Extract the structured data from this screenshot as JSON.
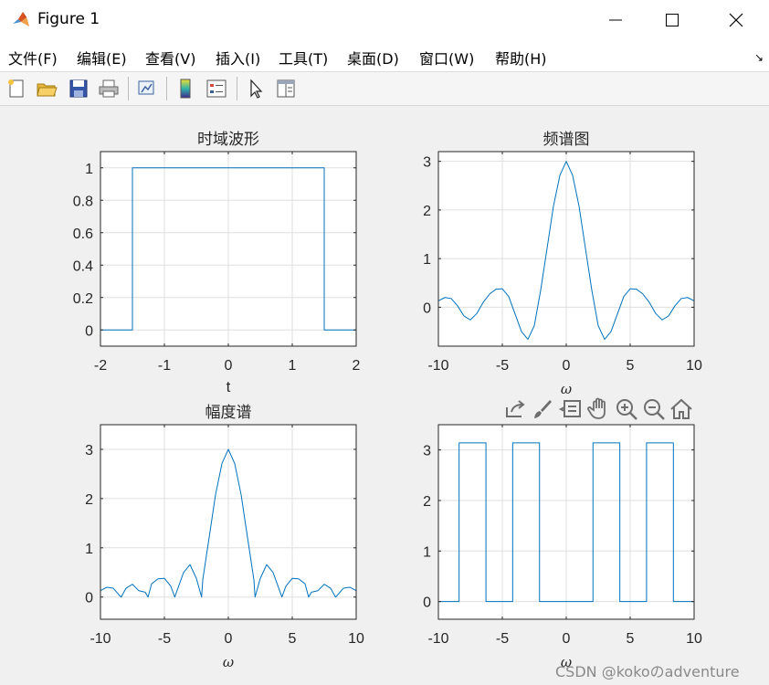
{
  "window": {
    "title": "Figure 1",
    "controls": [
      "minimize-icon",
      "maximize-icon",
      "close-icon"
    ]
  },
  "menu": [
    "文件(F)",
    "编辑(E)",
    "查看(V)",
    "插入(I)",
    "工具(T)",
    "桌面(D)",
    "窗口(W)",
    "帮助(H)"
  ],
  "toolbar": [
    "new-figure-icon",
    "open-file-icon",
    "save-icon",
    "print-icon",
    "link-plot-icon",
    "colorbar-icon",
    "legend-icon",
    "edit-plot-pointer-icon",
    "property-inspector-icon"
  ],
  "axes_toolbar": [
    "export-icon",
    "brush-icon",
    "data-tips-icon",
    "pan-hand-icon",
    "zoom-in-icon",
    "zoom-out-icon",
    "home-icon"
  ],
  "watermark": "CSDN @kokoのadventure",
  "colors": {
    "line": "#0072bd",
    "grid": "#dfdfdf",
    "axes_bg": "#ffffff",
    "figure_bg": "#f0f0f0"
  },
  "chart_data": [
    {
      "type": "line",
      "title": "时域波形",
      "xlabel": "t",
      "ylabel": "",
      "xlim": [
        -2,
        2
      ],
      "ylim": [
        -0.1,
        1.1
      ],
      "xticks": [
        -2,
        -1,
        0,
        1,
        2
      ],
      "yticks": [
        0,
        0.2,
        0.4,
        0.6,
        0.8,
        1
      ],
      "grid": true,
      "series": [
        {
          "x": [
            -2,
            -1.5,
            -1.5,
            1.5,
            1.5,
            2
          ],
          "y": [
            0,
            0,
            1,
            1,
            0,
            0
          ]
        }
      ]
    },
    {
      "type": "line",
      "title": "频谱图",
      "xlabel": "ω",
      "ylabel": "",
      "xlim": [
        -10,
        10
      ],
      "ylim": [
        -0.8,
        3.2
      ],
      "xticks": [
        -10,
        -5,
        0,
        5,
        10
      ],
      "yticks": [
        0,
        1,
        2,
        3
      ],
      "grid": true,
      "series": [
        {
          "x": [
            -10,
            -9.5,
            -9,
            -8.5,
            -8,
            -7.5,
            -7,
            -6.5,
            -6,
            -5.5,
            -5,
            -4.5,
            -4,
            -3.5,
            -3,
            -2.5,
            -2,
            -1.5,
            -1,
            -0.5,
            0,
            0.5,
            1,
            1.5,
            2,
            2.5,
            3,
            3.5,
            4,
            4.5,
            5,
            5.5,
            6,
            6.5,
            7,
            7.5,
            8,
            8.5,
            9,
            9.5,
            10
          ],
          "y": [
            0.13,
            0.2,
            0.18,
            0.03,
            -0.18,
            -0.26,
            -0.13,
            0.1,
            0.27,
            0.37,
            0.38,
            0.22,
            -0.14,
            -0.5,
            -0.66,
            -0.38,
            0.35,
            1.21,
            2.08,
            2.71,
            3.0,
            2.71,
            2.08,
            1.21,
            0.35,
            -0.38,
            -0.66,
            -0.5,
            -0.14,
            0.22,
            0.38,
            0.37,
            0.27,
            0.1,
            -0.13,
            -0.26,
            -0.18,
            0.03,
            0.18,
            0.2,
            0.13
          ]
        }
      ]
    },
    {
      "type": "line",
      "title": "幅度谱",
      "xlabel": "ω",
      "ylabel": "",
      "xlim": [
        -10,
        10
      ],
      "ylim": [
        -0.45,
        3.5
      ],
      "xticks": [
        -10,
        -5,
        0,
        5,
        10
      ],
      "yticks": [
        0,
        1,
        2,
        3
      ],
      "grid": true,
      "series": [
        {
          "x": [
            -10,
            -9.5,
            -9,
            -8.5,
            -8.38,
            -8,
            -7.5,
            -7,
            -6.5,
            -6.28,
            -6,
            -5.5,
            -5,
            -4.5,
            -4.19,
            -4,
            -3.5,
            -3,
            -2.5,
            -2.09,
            -2,
            -1.5,
            -1,
            -0.5,
            0,
            0.5,
            1,
            1.5,
            2,
            2.09,
            2.5,
            3,
            3.5,
            4,
            4.19,
            4.5,
            5,
            5.5,
            6,
            6.28,
            6.5,
            7,
            7.5,
            8,
            8.38,
            8.5,
            9,
            9.5,
            10
          ],
          "y": [
            0.13,
            0.2,
            0.18,
            0.03,
            0.0,
            0.18,
            0.26,
            0.13,
            0.1,
            0.0,
            0.27,
            0.37,
            0.38,
            0.22,
            0.0,
            0.14,
            0.5,
            0.66,
            0.38,
            0.0,
            0.35,
            1.21,
            2.08,
            2.71,
            3.0,
            2.71,
            2.08,
            1.21,
            0.35,
            0.0,
            0.38,
            0.66,
            0.5,
            0.14,
            0.0,
            0.22,
            0.38,
            0.37,
            0.27,
            0.0,
            0.1,
            0.13,
            0.26,
            0.18,
            0.0,
            0.03,
            0.18,
            0.2,
            0.13
          ]
        }
      ]
    },
    {
      "type": "line",
      "title": "",
      "xlabel": "ω",
      "ylabel": "",
      "xlim": [
        -10,
        10
      ],
      "ylim": [
        -0.35,
        3.5
      ],
      "xticks": [
        -10,
        -5,
        0,
        5,
        10
      ],
      "yticks": [
        0,
        1,
        2,
        3
      ],
      "grid": true,
      "series": [
        {
          "x": [
            -10,
            -8.38,
            -8.38,
            -6.28,
            -6.28,
            -4.19,
            -4.19,
            -2.09,
            -2.09,
            2.09,
            2.09,
            4.19,
            4.19,
            6.28,
            6.28,
            8.38,
            8.38,
            10
          ],
          "y": [
            0,
            0,
            3.1416,
            3.1416,
            0,
            0,
            3.1416,
            3.1416,
            0,
            0,
            3.1416,
            3.1416,
            0,
            0,
            3.1416,
            3.1416,
            0,
            0
          ]
        }
      ]
    }
  ]
}
